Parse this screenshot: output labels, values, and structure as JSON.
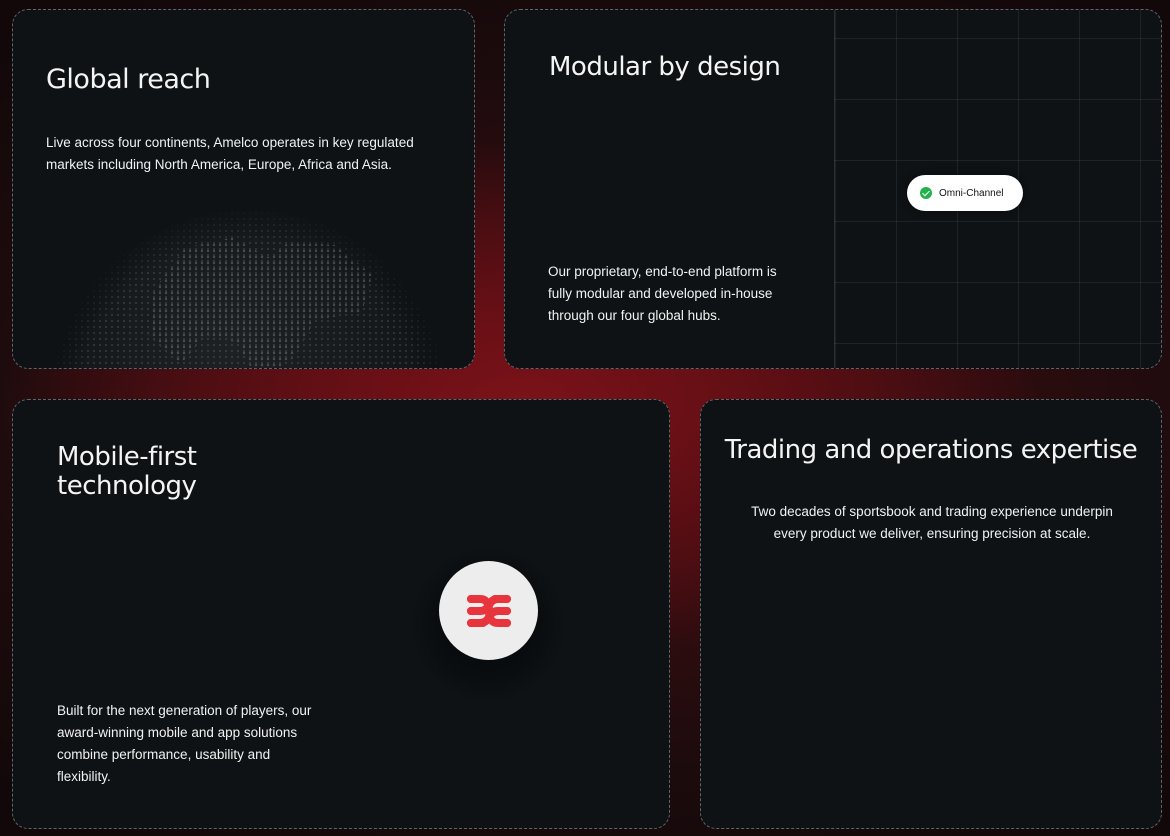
{
  "cards": {
    "global_reach": {
      "title": "Global reach",
      "body": "Live across four continents, Amelco operates in key regulated markets including North America, Europe, Africa and Asia."
    },
    "modular": {
      "title": "Modular by design",
      "body": "Our proprietary, end-to-end platform is fully modular and developed in-house through our four global hubs.",
      "pill_label": "Omni-Channel"
    },
    "mobile_first": {
      "title": "Mobile-first technology",
      "body": "Built for the next generation of players, our award-winning mobile and app solutions combine performance, usability and flexibility."
    },
    "trading": {
      "title": "Trading and operations expertise",
      "body": "Two decades of sportsbook and trading experience underpin every product we deliver, ensuring precision at scale."
    }
  },
  "colors": {
    "card_background": "#0e1215",
    "accent_red": "#e8343c",
    "check_green": "#22b14c"
  }
}
